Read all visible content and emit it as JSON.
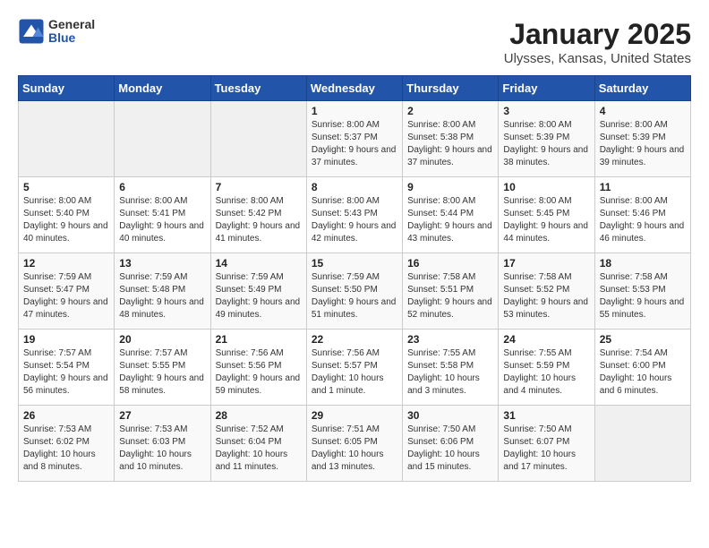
{
  "logo": {
    "general": "General",
    "blue": "Blue"
  },
  "title": "January 2025",
  "subtitle": "Ulysses, Kansas, United States",
  "days_of_week": [
    "Sunday",
    "Monday",
    "Tuesday",
    "Wednesday",
    "Thursday",
    "Friday",
    "Saturday"
  ],
  "weeks": [
    [
      {
        "day": "",
        "info": ""
      },
      {
        "day": "",
        "info": ""
      },
      {
        "day": "",
        "info": ""
      },
      {
        "day": "1",
        "info": "Sunrise: 8:00 AM\nSunset: 5:37 PM\nDaylight: 9 hours and 37 minutes."
      },
      {
        "day": "2",
        "info": "Sunrise: 8:00 AM\nSunset: 5:38 PM\nDaylight: 9 hours and 37 minutes."
      },
      {
        "day": "3",
        "info": "Sunrise: 8:00 AM\nSunset: 5:39 PM\nDaylight: 9 hours and 38 minutes."
      },
      {
        "day": "4",
        "info": "Sunrise: 8:00 AM\nSunset: 5:39 PM\nDaylight: 9 hours and 39 minutes."
      }
    ],
    [
      {
        "day": "5",
        "info": "Sunrise: 8:00 AM\nSunset: 5:40 PM\nDaylight: 9 hours and 40 minutes."
      },
      {
        "day": "6",
        "info": "Sunrise: 8:00 AM\nSunset: 5:41 PM\nDaylight: 9 hours and 40 minutes."
      },
      {
        "day": "7",
        "info": "Sunrise: 8:00 AM\nSunset: 5:42 PM\nDaylight: 9 hours and 41 minutes."
      },
      {
        "day": "8",
        "info": "Sunrise: 8:00 AM\nSunset: 5:43 PM\nDaylight: 9 hours and 42 minutes."
      },
      {
        "day": "9",
        "info": "Sunrise: 8:00 AM\nSunset: 5:44 PM\nDaylight: 9 hours and 43 minutes."
      },
      {
        "day": "10",
        "info": "Sunrise: 8:00 AM\nSunset: 5:45 PM\nDaylight: 9 hours and 44 minutes."
      },
      {
        "day": "11",
        "info": "Sunrise: 8:00 AM\nSunset: 5:46 PM\nDaylight: 9 hours and 46 minutes."
      }
    ],
    [
      {
        "day": "12",
        "info": "Sunrise: 7:59 AM\nSunset: 5:47 PM\nDaylight: 9 hours and 47 minutes."
      },
      {
        "day": "13",
        "info": "Sunrise: 7:59 AM\nSunset: 5:48 PM\nDaylight: 9 hours and 48 minutes."
      },
      {
        "day": "14",
        "info": "Sunrise: 7:59 AM\nSunset: 5:49 PM\nDaylight: 9 hours and 49 minutes."
      },
      {
        "day": "15",
        "info": "Sunrise: 7:59 AM\nSunset: 5:50 PM\nDaylight: 9 hours and 51 minutes."
      },
      {
        "day": "16",
        "info": "Sunrise: 7:58 AM\nSunset: 5:51 PM\nDaylight: 9 hours and 52 minutes."
      },
      {
        "day": "17",
        "info": "Sunrise: 7:58 AM\nSunset: 5:52 PM\nDaylight: 9 hours and 53 minutes."
      },
      {
        "day": "18",
        "info": "Sunrise: 7:58 AM\nSunset: 5:53 PM\nDaylight: 9 hours and 55 minutes."
      }
    ],
    [
      {
        "day": "19",
        "info": "Sunrise: 7:57 AM\nSunset: 5:54 PM\nDaylight: 9 hours and 56 minutes."
      },
      {
        "day": "20",
        "info": "Sunrise: 7:57 AM\nSunset: 5:55 PM\nDaylight: 9 hours and 58 minutes."
      },
      {
        "day": "21",
        "info": "Sunrise: 7:56 AM\nSunset: 5:56 PM\nDaylight: 9 hours and 59 minutes."
      },
      {
        "day": "22",
        "info": "Sunrise: 7:56 AM\nSunset: 5:57 PM\nDaylight: 10 hours and 1 minute."
      },
      {
        "day": "23",
        "info": "Sunrise: 7:55 AM\nSunset: 5:58 PM\nDaylight: 10 hours and 3 minutes."
      },
      {
        "day": "24",
        "info": "Sunrise: 7:55 AM\nSunset: 5:59 PM\nDaylight: 10 hours and 4 minutes."
      },
      {
        "day": "25",
        "info": "Sunrise: 7:54 AM\nSunset: 6:00 PM\nDaylight: 10 hours and 6 minutes."
      }
    ],
    [
      {
        "day": "26",
        "info": "Sunrise: 7:53 AM\nSunset: 6:02 PM\nDaylight: 10 hours and 8 minutes."
      },
      {
        "day": "27",
        "info": "Sunrise: 7:53 AM\nSunset: 6:03 PM\nDaylight: 10 hours and 10 minutes."
      },
      {
        "day": "28",
        "info": "Sunrise: 7:52 AM\nSunset: 6:04 PM\nDaylight: 10 hours and 11 minutes."
      },
      {
        "day": "29",
        "info": "Sunrise: 7:51 AM\nSunset: 6:05 PM\nDaylight: 10 hours and 13 minutes."
      },
      {
        "day": "30",
        "info": "Sunrise: 7:50 AM\nSunset: 6:06 PM\nDaylight: 10 hours and 15 minutes."
      },
      {
        "day": "31",
        "info": "Sunrise: 7:50 AM\nSunset: 6:07 PM\nDaylight: 10 hours and 17 minutes."
      },
      {
        "day": "",
        "info": ""
      }
    ]
  ]
}
